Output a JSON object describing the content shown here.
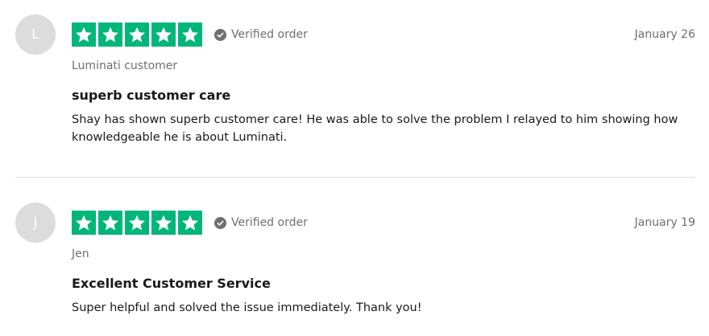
{
  "reviews": [
    {
      "avatar_initial": "L",
      "rating": 5,
      "verified_label": "Verified order",
      "date": "January 26",
      "author": "Luminati customer",
      "title": "superb customer care",
      "body": "Shay has shown superb customer care! He was able to solve the problem I relayed to him showing how knowledgeable he is about Luminati."
    },
    {
      "avatar_initial": "J",
      "rating": 5,
      "verified_label": "Verified order",
      "date": "January 19",
      "author": "Jen",
      "title": "Excellent Customer Service",
      "body": "Super helpful and solved the issue immediately. Thank you!"
    }
  ],
  "colors": {
    "star_background": "#00b67a",
    "muted_text": "#6f6f6f",
    "avatar_background": "#dcdcdc",
    "divider": "#dcdcdc"
  },
  "icons": {
    "star": "star-icon",
    "verified": "check-circle-icon"
  }
}
